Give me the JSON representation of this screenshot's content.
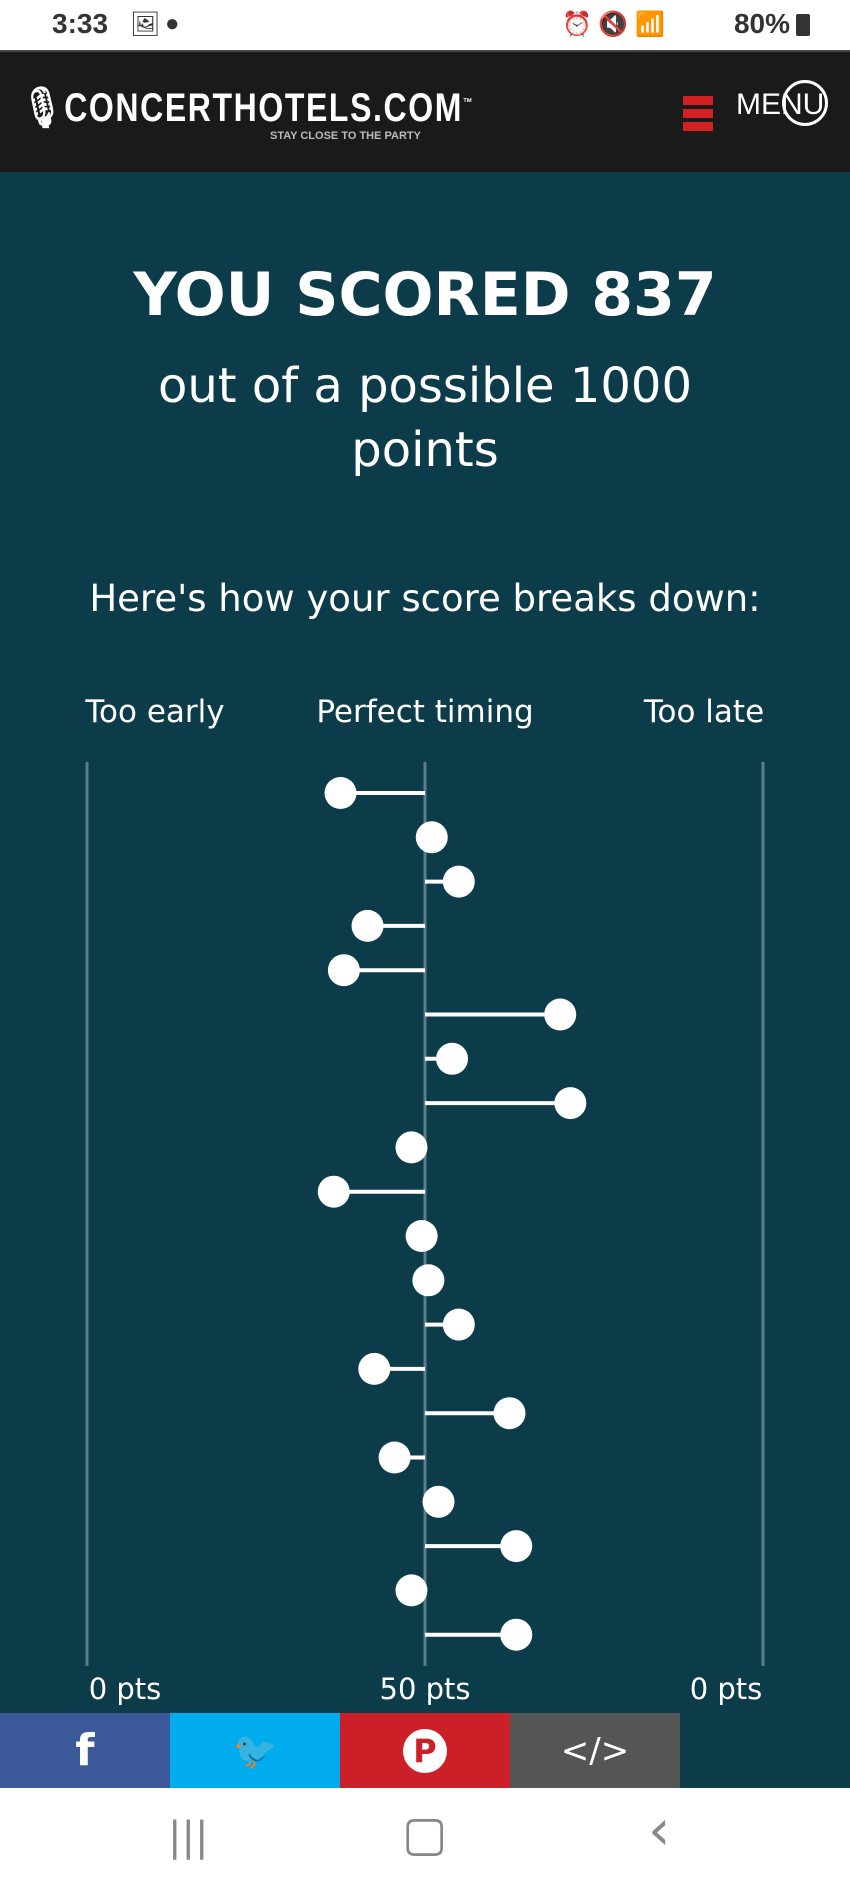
{
  "status_bar": {
    "time": "3:33",
    "battery": "80%",
    "icons": [
      "gallery-icon",
      "messenger-icon",
      "alarm-icon",
      "mute-icon",
      "wifi-icon",
      "signal-icon",
      "battery-icon"
    ]
  },
  "header": {
    "logo": "CONCERTHOTELS.COM",
    "tm": "™",
    "tagline": "STAY CLOSE TO THE PARTY",
    "menu_label": "MENU",
    "colors": {
      "menu_bar": "#d32020"
    }
  },
  "result": {
    "title": "YOU SCORED 837",
    "subtitle": "out of a possible 1000 points",
    "breakdown_label": "Here's how your score breaks down:"
  },
  "chart_data": {
    "type": "lollipop",
    "column_labels": [
      "Too early",
      "Perfect timing",
      "Too late"
    ],
    "bottom_labels": [
      "0 pts",
      "50 pts",
      "0 pts"
    ],
    "xlim": [
      -1,
      1
    ],
    "offsets": [
      -0.25,
      0.02,
      0.1,
      -0.17,
      -0.24,
      0.4,
      0.08,
      0.43,
      -0.04,
      -0.27,
      -0.01,
      0.01,
      0.1,
      -0.15,
      0.25,
      -0.09,
      0.04,
      0.27,
      -0.04,
      0.27
    ]
  },
  "share": [
    {
      "name": "facebook",
      "glyph": "f",
      "color": "#3b5998"
    },
    {
      "name": "twitter",
      "glyph": "🐦",
      "color": "#00acee"
    },
    {
      "name": "pinterest",
      "glyph": "P",
      "color": "#cb2027"
    },
    {
      "name": "embed",
      "glyph": "</>",
      "color": "#555555"
    }
  ],
  "nav": {
    "recent": "|||",
    "home": "▢",
    "back": "‹"
  }
}
